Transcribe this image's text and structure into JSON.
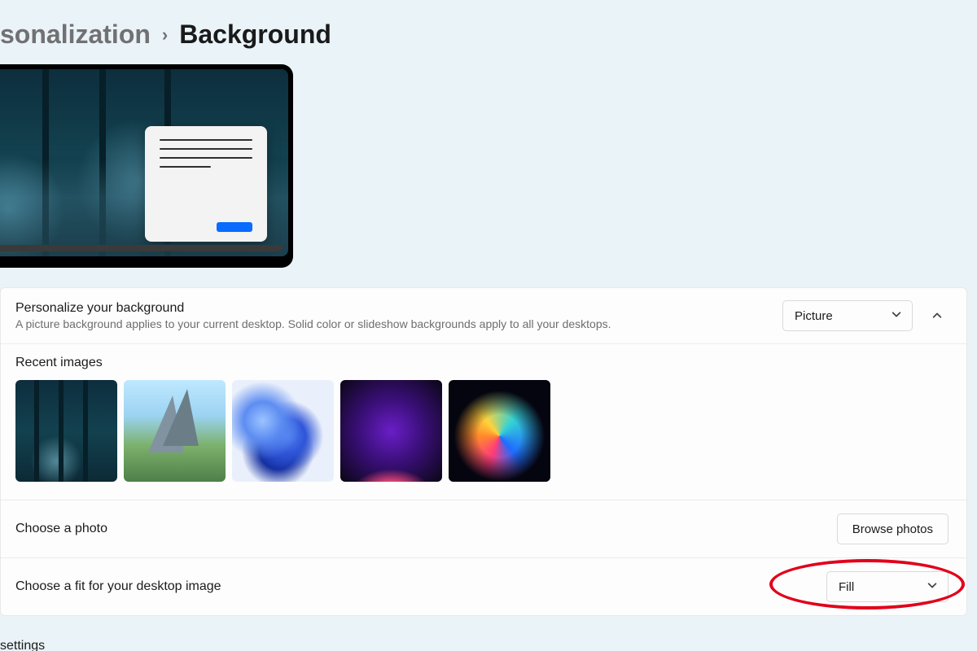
{
  "breadcrumb": {
    "parent": "sonalization",
    "current": "Background"
  },
  "personalize": {
    "title": "Personalize your background",
    "subtitle": "A picture background applies to your current desktop. Solid color or slideshow backgrounds apply to all your desktops.",
    "type_value": "Picture"
  },
  "recent": {
    "label": "Recent images"
  },
  "choose_photo": {
    "label": "Choose a photo",
    "button": "Browse photos"
  },
  "choose_fit": {
    "label": "Choose a fit for your desktop image",
    "value": "Fill"
  },
  "footer": {
    "label": "settings"
  }
}
